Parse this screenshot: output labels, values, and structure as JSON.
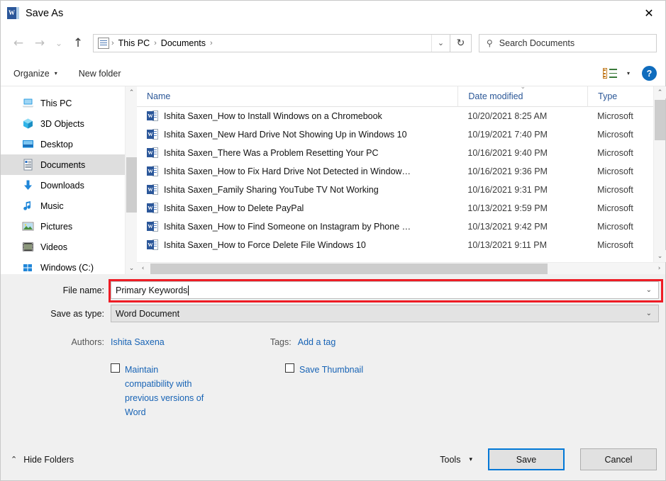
{
  "window": {
    "title": "Save As",
    "app_icon": "word-icon",
    "close_label": "✕"
  },
  "nav": {
    "back_icon": "←",
    "forward_icon": "→",
    "recent_icon": "⌄",
    "up_icon": "↑",
    "refresh_icon": "↻",
    "address_chevron": "⌄",
    "breadcrumbs": [
      "This PC",
      "Documents"
    ],
    "separator": "›"
  },
  "search": {
    "placeholder": "Search Documents",
    "icon": "search-icon"
  },
  "toolbar": {
    "organize_label": "Organize",
    "organize_caret": "▾",
    "new_folder_label": "New folder",
    "view_caret": "▾",
    "help_label": "?"
  },
  "sidebar": {
    "items": [
      {
        "label": "This PC",
        "icon": "this-pc-icon",
        "selected": false
      },
      {
        "label": "3D Objects",
        "icon": "3d-objects-icon",
        "selected": false
      },
      {
        "label": "Desktop",
        "icon": "desktop-icon",
        "selected": false
      },
      {
        "label": "Documents",
        "icon": "documents-icon",
        "selected": true
      },
      {
        "label": "Downloads",
        "icon": "downloads-icon",
        "selected": false
      },
      {
        "label": "Music",
        "icon": "music-icon",
        "selected": false
      },
      {
        "label": "Pictures",
        "icon": "pictures-icon",
        "selected": false
      },
      {
        "label": "Videos",
        "icon": "videos-icon",
        "selected": false
      },
      {
        "label": "Windows (C:)",
        "icon": "windows-drive-icon",
        "selected": false
      }
    ],
    "scroll_up_icon": "⌃",
    "scroll_down_icon": "⌄"
  },
  "file_list": {
    "columns": [
      "Name",
      "Date modified",
      "Type"
    ],
    "sort_column": "Date modified",
    "sort_caret": "⌄",
    "scroll_up_icon": "⌃",
    "scroll_down_icon": "⌄",
    "hscroll_left_icon": "‹",
    "hscroll_right_icon": "›",
    "rows": [
      {
        "name": "Ishita Saxen_How to Install Windows on a Chromebook",
        "date": "10/20/2021 8:25 AM",
        "type": "Microsoft",
        "icon": "word-doc-icon"
      },
      {
        "name": "Ishita Saxen_New Hard Drive Not Showing Up in Windows 10",
        "date": "10/19/2021 7:40 PM",
        "type": "Microsoft",
        "icon": "word-doc-icon"
      },
      {
        "name": "Ishita Saxen_There Was a Problem Resetting Your PC",
        "date": "10/16/2021 9:40 PM",
        "type": "Microsoft",
        "icon": "word-doc-icon"
      },
      {
        "name": "Ishita Saxen_How to Fix Hard Drive Not Detected in Window…",
        "date": "10/16/2021 9:36 PM",
        "type": "Microsoft",
        "icon": "word-doc-icon"
      },
      {
        "name": "Ishita Saxen_Family Sharing YouTube TV Not Working",
        "date": "10/16/2021 9:31 PM",
        "type": "Microsoft",
        "icon": "word-doc-icon"
      },
      {
        "name": "Ishita Saxen_How to Delete PayPal",
        "date": "10/13/2021 9:59 PM",
        "type": "Microsoft",
        "icon": "word-doc-icon"
      },
      {
        "name": "Ishita Saxen_How to Find Someone on Instagram by Phone …",
        "date": "10/13/2021 9:42 PM",
        "type": "Microsoft",
        "icon": "word-doc-icon"
      },
      {
        "name": "Ishita Saxen_How to Force Delete File Windows 10",
        "date": "10/13/2021 9:11 PM",
        "type": "Microsoft",
        "icon": "word-doc-icon"
      }
    ]
  },
  "form": {
    "file_name_label": "File name:",
    "file_name_value": "Primary Keywords",
    "save_as_type_label": "Save as type:",
    "save_as_type_value": "Word Document",
    "authors_label": "Authors:",
    "authors_value": "Ishita Saxena",
    "tags_label": "Tags:",
    "tags_value": "Add a tag",
    "maintain_compat_label": "Maintain compatibility with previous versions of Word",
    "maintain_compat_checked": false,
    "save_thumbnail_label": "Save Thumbnail",
    "save_thumbnail_checked": false,
    "combo_caret": "⌄"
  },
  "footer": {
    "hide_folders_label": "Hide Folders",
    "hide_folders_caret": "⌃",
    "tools_label": "Tools",
    "tools_caret": "▾",
    "save_label": "Save",
    "cancel_label": "Cancel"
  },
  "colors": {
    "accent_blue": "#0078d7",
    "header_blue": "#2b5797",
    "link_blue": "#1763b5",
    "highlight_red": "#ee1c25",
    "selection_gray": "#dedede"
  }
}
